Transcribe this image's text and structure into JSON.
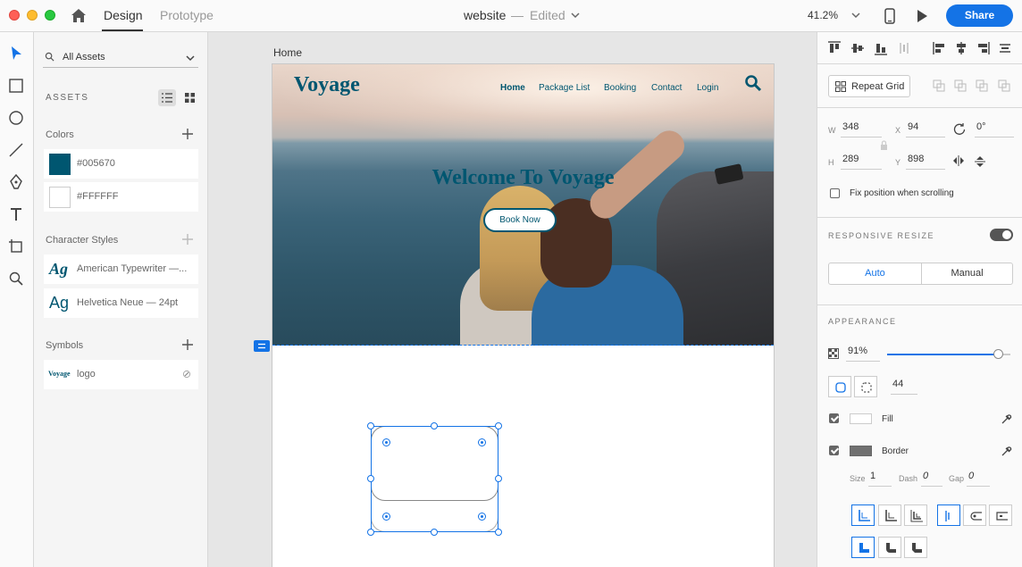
{
  "titlebar": {
    "tabs": [
      {
        "label": "Design",
        "active": true
      },
      {
        "label": "Prototype",
        "active": false
      }
    ],
    "doc_name": "website",
    "doc_sep": "—",
    "doc_status": "Edited",
    "zoom": "41.2%",
    "share_label": "Share"
  },
  "tools": [
    "select-icon",
    "rectangle-icon",
    "ellipse-icon",
    "line-icon",
    "pen-icon",
    "text-icon",
    "artboard-icon",
    "zoom-icon"
  ],
  "assets": {
    "search_label": "All Assets",
    "heading": "ASSETS",
    "colors_label": "Colors",
    "colors": [
      {
        "hex": "#005670",
        "label": "#005670"
      },
      {
        "hex": "#FFFFFF",
        "label": "#FFFFFF"
      }
    ],
    "char_styles_label": "Character Styles",
    "char_styles": [
      {
        "sample": "Ag",
        "label": "American Typewriter —..."
      },
      {
        "sample": "Ag",
        "label": "Helvetica Neue — 24pt"
      }
    ],
    "symbols_label": "Symbols",
    "symbols": [
      {
        "thumb": "Voyage",
        "label": "logo"
      }
    ]
  },
  "canvas": {
    "artboard_label": "Home",
    "site": {
      "logo": "Voyage",
      "nav": [
        "Home",
        "Package List",
        "Booking",
        "Contact",
        "Login"
      ],
      "hero_title": "Welcome To Voyage",
      "cta": "Book Now",
      "brand_color": "#005670"
    }
  },
  "inspector": {
    "repeat_grid": "Repeat Grid",
    "w_label": "W",
    "w": "348",
    "x_label": "X",
    "x": "94",
    "rotation": "0°",
    "h_label": "H",
    "h": "289",
    "y_label": "Y",
    "y": "898",
    "fix_position": "Fix position when scrolling",
    "responsive_resize": "RESPONSIVE RESIZE",
    "responsive_on": true,
    "resize_auto": "Auto",
    "resize_manual": "Manual",
    "appearance": "APPEARANCE",
    "opacity": "91%",
    "opacity_value": 0.91,
    "corner_radius": "44",
    "fill_label": "Fill",
    "border_label": "Border",
    "size_label": "Size",
    "size": "1",
    "dash_label": "Dash",
    "dash": "0",
    "gap_label": "Gap",
    "gap": "0",
    "accent": "#1473e6"
  }
}
